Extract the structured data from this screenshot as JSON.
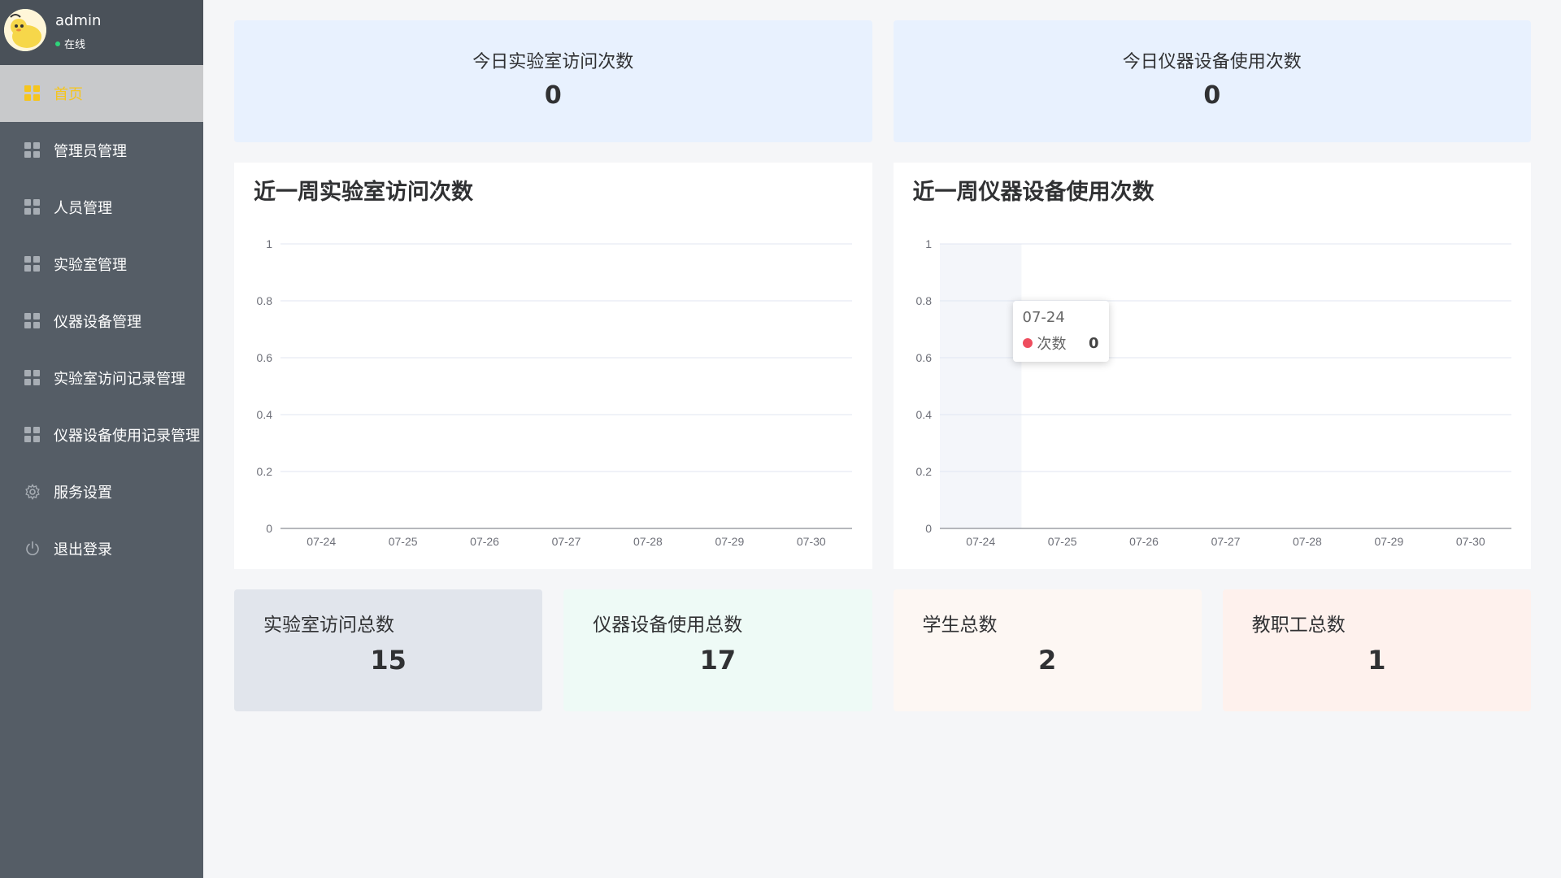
{
  "user": {
    "name": "admin",
    "status": "在线"
  },
  "menu": [
    {
      "label": "首页",
      "icon": "grid-icon",
      "active": true
    },
    {
      "label": "管理员管理",
      "icon": "grid-icon"
    },
    {
      "label": "人员管理",
      "icon": "grid-icon"
    },
    {
      "label": "实验室管理",
      "icon": "grid-icon"
    },
    {
      "label": "仪器设备管理",
      "icon": "grid-icon"
    },
    {
      "label": "实验室访问记录管理",
      "icon": "grid-icon"
    },
    {
      "label": "仪器设备使用记录管理",
      "icon": "grid-icon"
    },
    {
      "label": "服务设置",
      "icon": "gear-icon"
    },
    {
      "label": "退出登录",
      "icon": "power-icon"
    }
  ],
  "top_stats": [
    {
      "label": "今日实验室访问次数",
      "value": "0"
    },
    {
      "label": "今日仪器设备使用次数",
      "value": "0"
    }
  ],
  "chart_data": [
    {
      "type": "line",
      "title": "近一周实验室访问次数",
      "categories": [
        "07-24",
        "07-25",
        "07-26",
        "07-27",
        "07-28",
        "07-29",
        "07-30"
      ],
      "series": [
        {
          "values": [
            0,
            0,
            0,
            0,
            0,
            0,
            0
          ]
        }
      ],
      "yticks": [
        "0",
        "0.2",
        "0.4",
        "0.6",
        "0.8",
        "1"
      ],
      "ylim": [
        0,
        1
      ],
      "grid": true
    },
    {
      "type": "line",
      "title": "近一周仪器设备使用次数",
      "categories": [
        "07-24",
        "07-25",
        "07-26",
        "07-27",
        "07-28",
        "07-29",
        "07-30"
      ],
      "series": [
        {
          "name": "次数",
          "values": [
            0,
            0,
            0,
            0,
            0,
            0,
            0
          ]
        }
      ],
      "yticks": [
        "0",
        "0.2",
        "0.4",
        "0.6",
        "0.8",
        "1"
      ],
      "ylim": [
        0,
        1
      ],
      "grid": true,
      "tooltip": {
        "category": "07-24",
        "series": "次数",
        "value": "0"
      }
    }
  ],
  "bottom_stats": [
    {
      "label": "实验室访问总数",
      "value": "15",
      "bg": "#e1e5ec"
    },
    {
      "label": "仪器设备使用总数",
      "value": "17",
      "bg": "#eefaf6"
    },
    {
      "label": "学生总数",
      "value": "2",
      "bg": "#fdf7f3"
    },
    {
      "label": "教职工总数",
      "value": "1",
      "bg": "#fef1ed"
    }
  ],
  "colors": {
    "sidebar": "#555d66",
    "active_text": "#f5c51e",
    "tooltip_dot": "#ee4d5e"
  }
}
